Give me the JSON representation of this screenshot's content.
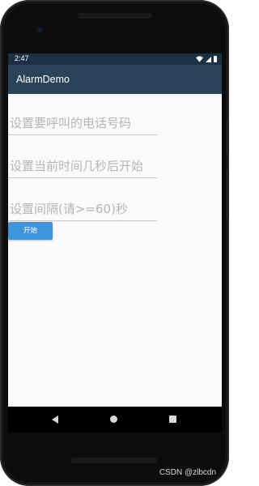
{
  "status_bar": {
    "time": "2:47",
    "icons": [
      "wifi-icon",
      "signal-icon",
      "battery-icon"
    ]
  },
  "app_bar": {
    "title": "AlarmDemo",
    "color": "#2b4359"
  },
  "form": {
    "phone_field": {
      "placeholder": "设置要呼叫的电话号码",
      "value": ""
    },
    "delay_field": {
      "placeholder": "设置当前时间几秒后开始",
      "value": ""
    },
    "interval_field": {
      "placeholder": "设置间隔(请>=60)秒",
      "value": ""
    },
    "start_button": {
      "label": "开始",
      "color": "#3f95dd"
    }
  },
  "nav_bar": {
    "icons": [
      "back-icon",
      "home-icon",
      "recents-icon"
    ]
  },
  "watermark": "CSDN @zlbcdn"
}
